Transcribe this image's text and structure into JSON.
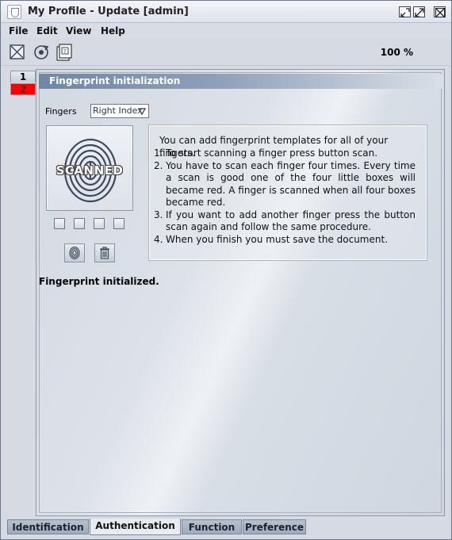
{
  "window": {
    "title": "My Profile - Update [admin]"
  },
  "menu": {
    "items": [
      "File",
      "Edit",
      "View",
      "Help"
    ]
  },
  "toolbar": {
    "zoom": "100 %",
    "buttons": [
      "close-document-icon",
      "refresh-icon",
      "help-icon"
    ]
  },
  "steps": [
    "1",
    "2"
  ],
  "panel": {
    "header": "Fingerprint initialization",
    "fingers_label": "Fingers",
    "fingers_selected": "Right Index",
    "scanned_label": "SCANNED",
    "status": "Fingerprint initialized.",
    "info_title": "You can add fingerprint templates for all of your fingers.",
    "instructions": [
      {
        "num": "1.",
        "text": "To start scanning a finger press button scan."
      },
      {
        "num": "2.",
        "text": "You have to scan each finger four times. Every time a scan is good one of the four little boxes will became red. A finger is scanned when all four boxes became red."
      },
      {
        "num": "3.",
        "text": "If you want to add another finger press the button scan again and follow the same procedure."
      },
      {
        "num": "4.",
        "text": "When you finish you must save the document."
      }
    ]
  },
  "bottom_tabs": [
    "Identification",
    "Authentication",
    "Function",
    "Preference"
  ],
  "colors": {
    "header_accent": "#6f86a6",
    "step_active": "#ff0000"
  }
}
